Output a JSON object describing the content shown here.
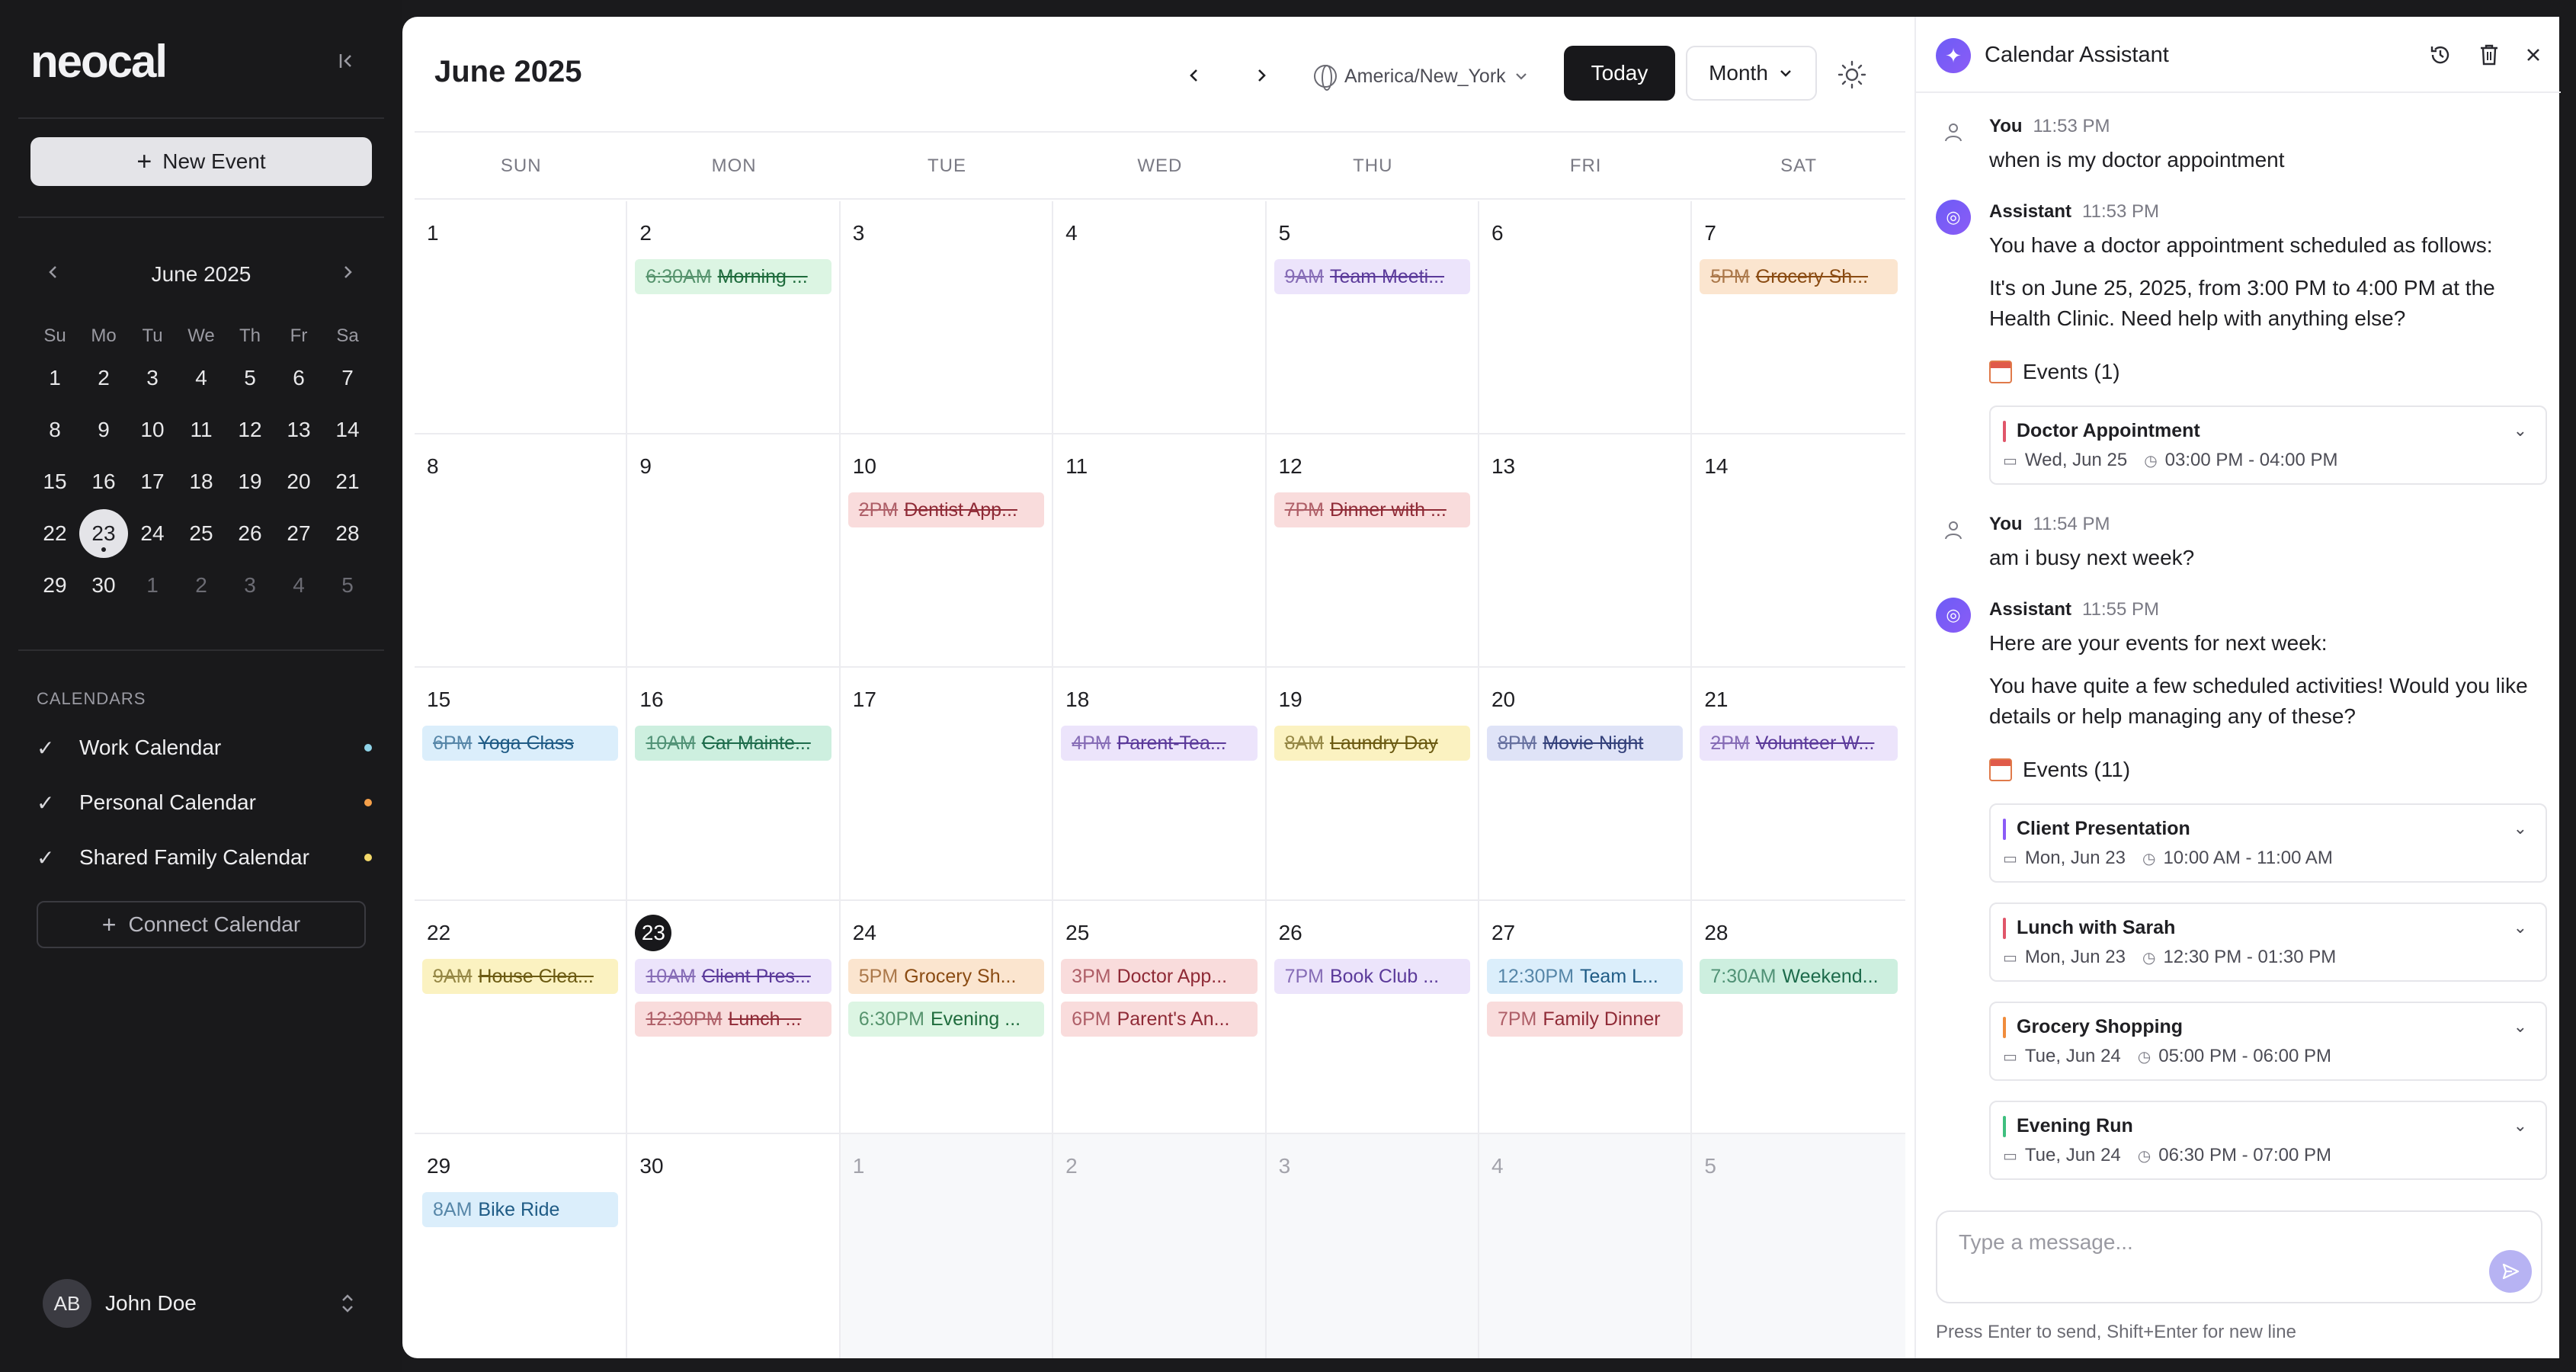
{
  "colors": {
    "accent": "#7c5cf6",
    "dot_work": "#8fd3e8",
    "dot_personal": "#f5a04a",
    "dot_family": "#f3d86a"
  },
  "sidebar": {
    "logo": "neocal",
    "new_event": "New Event",
    "mini_calendar": {
      "title": "June 2025",
      "weekdays": [
        "Su",
        "Mo",
        "Tu",
        "We",
        "Th",
        "Fr",
        "Sa"
      ],
      "weeks": [
        [
          "1",
          "2",
          "3",
          "4",
          "5",
          "6",
          "7"
        ],
        [
          "8",
          "9",
          "10",
          "11",
          "12",
          "13",
          "14"
        ],
        [
          "15",
          "16",
          "17",
          "18",
          "19",
          "20",
          "21"
        ],
        [
          "22",
          "23",
          "24",
          "25",
          "26",
          "27",
          "28"
        ],
        [
          "29",
          "30",
          "1",
          "2",
          "3",
          "4",
          "5"
        ]
      ],
      "today": "23"
    },
    "calendars_heading": "CALENDARS",
    "calendars": [
      {
        "label": "Work Calendar"
      },
      {
        "label": "Personal Calendar"
      },
      {
        "label": "Shared Family Calendar"
      }
    ],
    "connect_calendar": "Connect Calendar",
    "user": {
      "initials": "AB",
      "name": "John Doe"
    }
  },
  "main": {
    "title": "June 2025",
    "timezone": "America/New_York",
    "today_label": "Today",
    "view_label": "Month",
    "weekdays": [
      "SUN",
      "MON",
      "TUE",
      "WED",
      "THU",
      "FRI",
      "SAT"
    ],
    "weeks": [
      [
        {
          "day": "1",
          "events": []
        },
        {
          "day": "2",
          "events": [
            {
              "time": "6:30AM",
              "title": "Morning ...",
              "color": "green",
              "done": true
            }
          ]
        },
        {
          "day": "3",
          "events": []
        },
        {
          "day": "4",
          "events": []
        },
        {
          "day": "5",
          "events": [
            {
              "time": "9AM",
              "title": "Team Meeti...",
              "color": "purple",
              "done": true
            }
          ]
        },
        {
          "day": "6",
          "events": []
        },
        {
          "day": "7",
          "events": [
            {
              "time": "5PM",
              "title": "Grocery Sh...",
              "color": "orange",
              "done": true
            }
          ]
        }
      ],
      [
        {
          "day": "8",
          "events": []
        },
        {
          "day": "9",
          "events": []
        },
        {
          "day": "10",
          "events": [
            {
              "time": "2PM",
              "title": "Dentist App...",
              "color": "red",
              "done": true
            }
          ]
        },
        {
          "day": "11",
          "events": []
        },
        {
          "day": "12",
          "events": [
            {
              "time": "7PM",
              "title": "Dinner with ...",
              "color": "red",
              "done": true
            }
          ]
        },
        {
          "day": "13",
          "events": []
        },
        {
          "day": "14",
          "events": []
        }
      ],
      [
        {
          "day": "15",
          "events": [
            {
              "time": "6PM",
              "title": "Yoga Class",
              "color": "blue",
              "done": true
            }
          ]
        },
        {
          "day": "16",
          "events": [
            {
              "time": "10AM",
              "title": "Car Mainte...",
              "color": "teal",
              "done": true
            }
          ]
        },
        {
          "day": "17",
          "events": []
        },
        {
          "day": "18",
          "events": [
            {
              "time": "4PM",
              "title": "Parent-Tea...",
              "color": "purple",
              "done": true
            }
          ]
        },
        {
          "day": "19",
          "events": [
            {
              "time": "8AM",
              "title": "Laundry Day",
              "color": "yellow",
              "done": true
            }
          ]
        },
        {
          "day": "20",
          "events": [
            {
              "time": "8PM",
              "title": "Movie Night",
              "color": "indigo",
              "done": true
            }
          ]
        },
        {
          "day": "21",
          "events": [
            {
              "time": "2PM",
              "title": "Volunteer W...",
              "color": "purple",
              "done": true
            }
          ]
        }
      ],
      [
        {
          "day": "22",
          "events": [
            {
              "time": "9AM",
              "title": "House Clea...",
              "color": "yellow",
              "done": true
            }
          ]
        },
        {
          "day": "23",
          "today": true,
          "events": [
            {
              "time": "10AM",
              "title": "Client Pres...",
              "color": "purple",
              "done": true
            },
            {
              "time": "12:30PM",
              "title": "Lunch ...",
              "color": "red",
              "done": true
            }
          ]
        },
        {
          "day": "24",
          "events": [
            {
              "time": "5PM",
              "title": "Grocery Sh...",
              "color": "orange",
              "done": false
            },
            {
              "time": "6:30PM",
              "title": "Evening ...",
              "color": "green",
              "done": false
            }
          ]
        },
        {
          "day": "25",
          "events": [
            {
              "time": "3PM",
              "title": "Doctor App...",
              "color": "red",
              "done": false
            },
            {
              "time": "6PM",
              "title": "Parent's An...",
              "color": "red",
              "done": false
            }
          ]
        },
        {
          "day": "26",
          "events": [
            {
              "time": "7PM",
              "title": "Book Club ...",
              "color": "purple",
              "done": false
            }
          ]
        },
        {
          "day": "27",
          "events": [
            {
              "time": "12:30PM",
              "title": "Team L...",
              "color": "blue",
              "done": false
            },
            {
              "time": "7PM",
              "title": "Family Dinner",
              "color": "red",
              "done": false
            }
          ]
        },
        {
          "day": "28",
          "events": [
            {
              "time": "7:30AM",
              "title": "Weekend...",
              "color": "teal",
              "done": false
            }
          ]
        }
      ],
      [
        {
          "day": "29",
          "events": [
            {
              "time": "8AM",
              "title": "Bike Ride",
              "color": "blue",
              "done": false
            }
          ]
        },
        {
          "day": "30",
          "events": []
        },
        {
          "day": "1",
          "other": true,
          "events": []
        },
        {
          "day": "2",
          "other": true,
          "events": []
        },
        {
          "day": "3",
          "other": true,
          "events": []
        },
        {
          "day": "4",
          "other": true,
          "events": []
        },
        {
          "day": "5",
          "other": true,
          "events": []
        }
      ]
    ]
  },
  "assistant": {
    "title": "Calendar Assistant",
    "messages": [
      {
        "role": "user",
        "who": "You",
        "time": "11:53 PM",
        "text": [
          "when is my doctor appointment"
        ]
      },
      {
        "role": "bot",
        "who": "Assistant",
        "time": "11:53 PM",
        "text": [
          "You have a doctor appointment scheduled as follows:",
          "It's on June 25, 2025, from 3:00 PM to 4:00 PM at the Health Clinic. Need help with anything else?"
        ],
        "events_label": "Events (1)",
        "events": [
          {
            "name": "Doctor Appointment",
            "date": "Wed, Jun 25",
            "time": "03:00 PM - 04:00 PM",
            "color": "red"
          }
        ]
      },
      {
        "role": "user",
        "who": "You",
        "time": "11:54 PM",
        "text": [
          "am i busy next week?"
        ]
      },
      {
        "role": "bot",
        "who": "Assistant",
        "time": "11:55 PM",
        "text": [
          "Here are your events for next week:",
          "You have quite a few scheduled activities! Would you like details or help managing any of these?"
        ],
        "events_label": "Events (11)",
        "events": [
          {
            "name": "Client Presentation",
            "date": "Mon, Jun 23",
            "time": "10:00 AM - 11:00 AM",
            "color": "purple"
          },
          {
            "name": "Lunch with Sarah",
            "date": "Mon, Jun 23",
            "time": "12:30 PM - 01:30 PM",
            "color": "red"
          },
          {
            "name": "Grocery Shopping",
            "date": "Tue, Jun 24",
            "time": "05:00 PM - 06:00 PM",
            "color": "orange"
          },
          {
            "name": "Evening Run",
            "date": "Tue, Jun 24",
            "time": "06:30 PM - 07:00 PM",
            "color": "green"
          }
        ]
      }
    ],
    "composer_placeholder": "Type a message...",
    "hint": "Press Enter to send, Shift+Enter for new line"
  }
}
